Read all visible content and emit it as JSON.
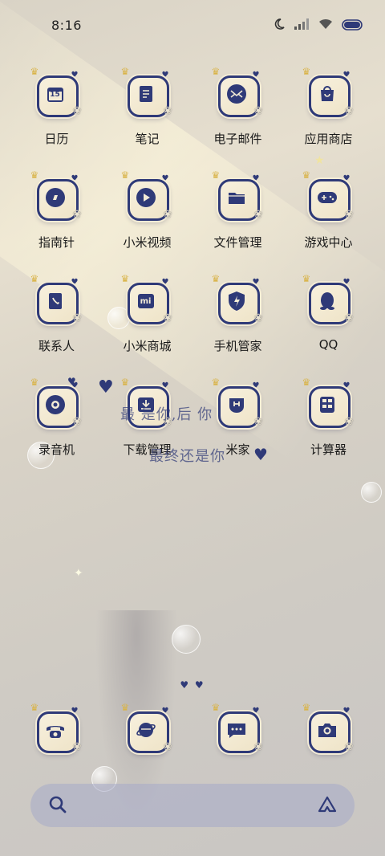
{
  "status": {
    "time": "8:16",
    "icons": [
      "moon-icon",
      "signal-icon",
      "wifi-icon",
      "battery-icon"
    ]
  },
  "apps": [
    {
      "label": "日历",
      "icon": "calendar-icon",
      "glyph": "15"
    },
    {
      "label": "笔记",
      "icon": "notes-icon",
      "glyph": ""
    },
    {
      "label": "电子邮件",
      "icon": "mail-icon",
      "glyph": ""
    },
    {
      "label": "应用商店",
      "icon": "app-store-icon",
      "glyph": ""
    },
    {
      "label": "指南针",
      "icon": "compass-icon",
      "glyph": ""
    },
    {
      "label": "小米视频",
      "icon": "video-icon",
      "glyph": ""
    },
    {
      "label": "文件管理",
      "icon": "folder-icon",
      "glyph": ""
    },
    {
      "label": "游戏中心",
      "icon": "gamepad-icon",
      "glyph": ""
    },
    {
      "label": "联系人",
      "icon": "contacts-icon",
      "glyph": ""
    },
    {
      "label": "小米商城",
      "icon": "mi-store-icon",
      "glyph": "mi"
    },
    {
      "label": "手机管家",
      "icon": "security-shield-icon",
      "glyph": ""
    },
    {
      "label": "QQ",
      "icon": "qq-penguin-icon",
      "glyph": ""
    },
    {
      "label": "录音机",
      "icon": "recorder-icon",
      "glyph": ""
    },
    {
      "label": "下载管理",
      "icon": "download-icon",
      "glyph": ""
    },
    {
      "label": "米家",
      "icon": "mijia-icon",
      "glyph": ""
    },
    {
      "label": "计算器",
      "icon": "calculator-icon",
      "glyph": ""
    }
  ],
  "dock": [
    {
      "icon": "phone-icon"
    },
    {
      "icon": "browser-planet-icon"
    },
    {
      "icon": "messages-icon"
    },
    {
      "icon": "camera-icon"
    }
  ],
  "wallpaper_text": {
    "line1": "最 是你,后 你",
    "line2": "最终还是你"
  },
  "page_indicator": "♥ ♥",
  "colors": {
    "accent": "#2f3a78",
    "frame_fill": "#f4ecd6",
    "crown": "#d9b44a"
  }
}
